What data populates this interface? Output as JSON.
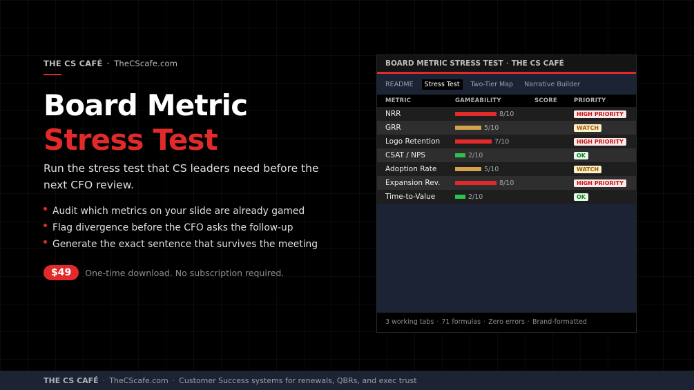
{
  "brand": {
    "name": "THE CS CAFÉ",
    "separator": "·",
    "site": "TheCScafe.com"
  },
  "hero": {
    "title_line1": "Board Metric",
    "title_line2": "Stress Test",
    "subtitle": "Run the stress test that CS leaders need before the next CFO review.",
    "bullets": [
      "Audit which metrics on your slide are already gamed",
      "Flag divergence before the CFO asks the follow-up",
      "Generate the exact sentence that survives the meeting"
    ],
    "price": "$49",
    "price_note": "One-time download. No subscription required."
  },
  "panel": {
    "header": "BOARD METRIC STRESS TEST",
    "header_separator": "·",
    "header_brand": "THE CS CAFÉ",
    "tabs": [
      {
        "label": "README",
        "active": false
      },
      {
        "label": "Stress Test",
        "active": true
      },
      {
        "label": "Two-Tier Map",
        "active": false
      },
      {
        "label": "Narrative Builder",
        "active": false
      }
    ],
    "columns": [
      "METRIC",
      "GAMEABILITY",
      "SCORE",
      "PRIORITY"
    ],
    "rows": [
      {
        "metric": "NRR",
        "gameability": 8,
        "display": "8/10",
        "bar_color": "#e12a2a",
        "priority": "HIGH PRIORITY",
        "level": "high"
      },
      {
        "metric": "GRR",
        "gameability": 5,
        "display": "5/10",
        "bar_color": "#d4a24c",
        "priority": "WATCH",
        "level": "watch"
      },
      {
        "metric": "Logo Retention",
        "gameability": 7,
        "display": "7/10",
        "bar_color": "#e12a2a",
        "priority": "HIGH PRIORITY",
        "level": "high"
      },
      {
        "metric": "CSAT / NPS",
        "gameability": 2,
        "display": "2/10",
        "bar_color": "#2fbf4f",
        "priority": "OK",
        "level": "ok"
      },
      {
        "metric": "Adoption Rate",
        "gameability": 5,
        "display": "5/10",
        "bar_color": "#d4a24c",
        "priority": "WATCH",
        "level": "watch"
      },
      {
        "metric": "Expansion Rev.",
        "gameability": 8,
        "display": "8/10",
        "bar_color": "#e12a2a",
        "priority": "HIGH PRIORITY",
        "level": "high"
      },
      {
        "metric": "Time-to-Value",
        "gameability": 2,
        "display": "2/10",
        "bar_color": "#2fbf4f",
        "priority": "OK",
        "level": "ok"
      }
    ],
    "footer": [
      "3 working tabs",
      "71 formulas",
      "Zero errors",
      "Brand-formatted"
    ],
    "footer_separator": "·"
  },
  "footer": {
    "brand": "THE CS CAFÉ",
    "site": "TheCScafe.com",
    "tagline": "Customer Success systems for renewals, QBRs, and exec trust",
    "separator": "·"
  },
  "colors": {
    "accent": "#e12a2a",
    "watch": "#d4a24c",
    "ok": "#2fbf4f",
    "panel_bg": "#1b2334"
  }
}
